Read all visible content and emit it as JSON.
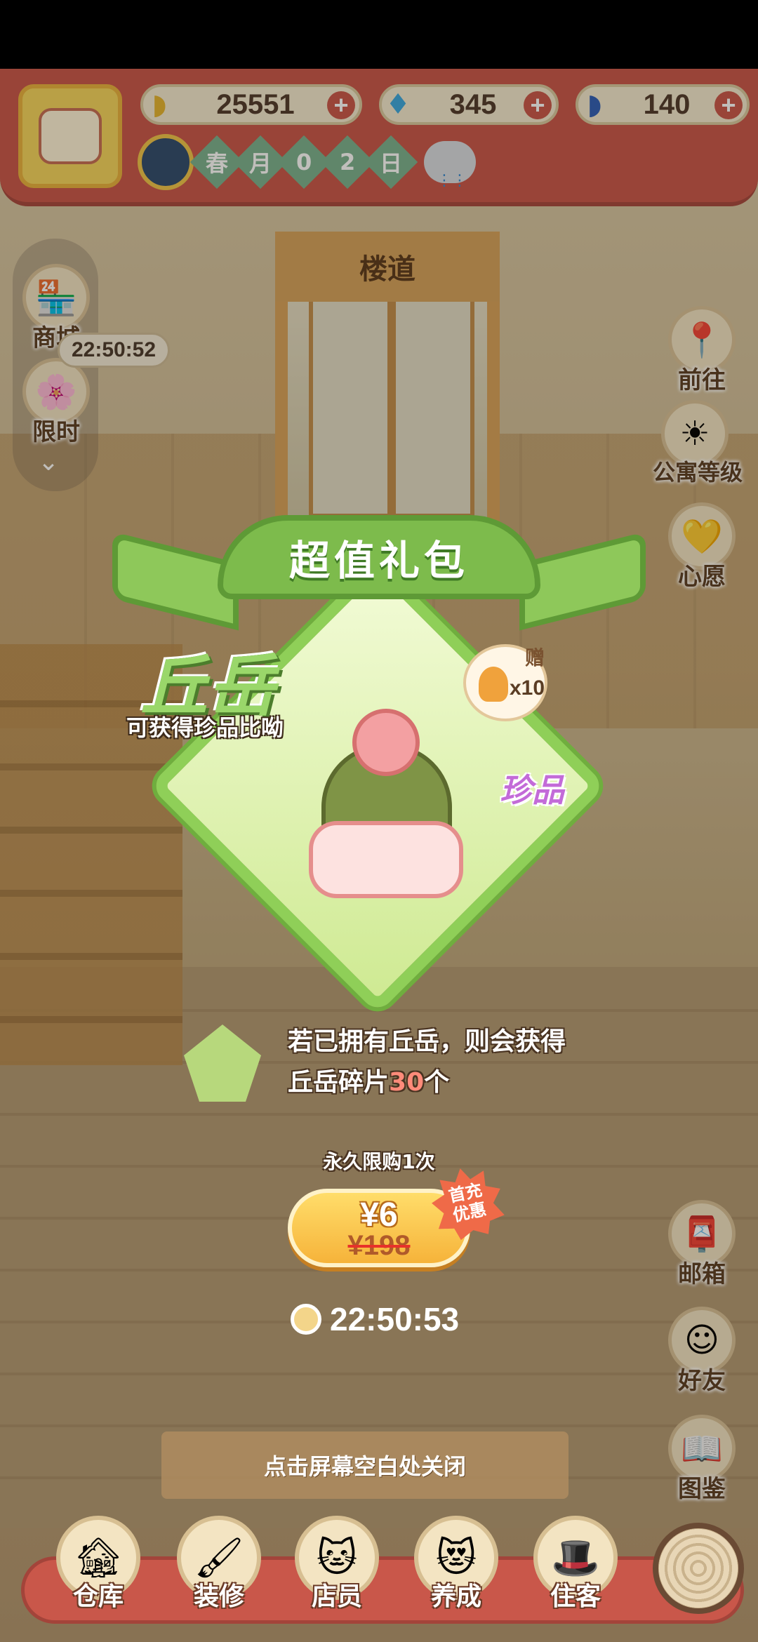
{
  "resources": [
    {
      "name": "banana",
      "icon": "banana-icon",
      "value": "25551"
    },
    {
      "name": "flame",
      "icon": "blue-flame-icon",
      "value": "345"
    },
    {
      "name": "blue-banana",
      "icon": "blue-banana-icon",
      "value": "140"
    }
  ],
  "date": {
    "season": "春",
    "unit": "月",
    "d1": "0",
    "d2": "2",
    "day": "日"
  },
  "location_sign": "楼道",
  "left_menu": {
    "shop": "商城",
    "limited": "限时",
    "timer": "22:50:52"
  },
  "right_menu": {
    "goto": "前往",
    "apt_level": "公寓等级",
    "wish": "心愿",
    "mail": "邮箱",
    "friends": "好友",
    "guide": "图鉴"
  },
  "popup": {
    "title": "超值礼包",
    "character_name": "丘岳",
    "character_sub": "可获得珍品比呦",
    "gift_tag": "赠",
    "gift_qty": "x10",
    "rarity": "珍品",
    "dup_line1": "若已拥有丘岳，则会获得",
    "dup_line2_pre": "丘岳碎片",
    "dup_line2_num": "30",
    "dup_line2_post": "个",
    "limit": "永久限购1次",
    "price": "¥6",
    "original_price": "¥198",
    "first_badge": "首充优惠",
    "countdown": "22:50:53",
    "close_hint": "点击屏幕空白处关闭"
  },
  "bottom_nav": [
    "仓库",
    "装修",
    "店员",
    "养成",
    "住客"
  ],
  "colors": {
    "hud": "#c9574a",
    "ribbon": "#7dbb4c",
    "button": "#f6b33a",
    "rare": "#c36bd8"
  }
}
